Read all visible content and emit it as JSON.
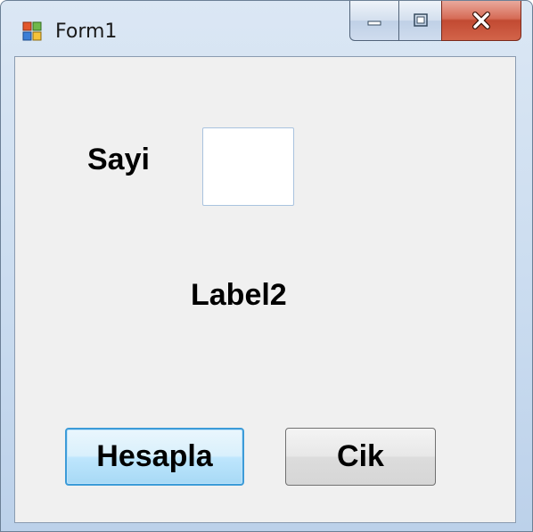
{
  "window": {
    "title": "Form1"
  },
  "form": {
    "sayi_label": "Sayi",
    "sayi_input_value": "",
    "result_label": "Label2",
    "hesapla_button": "Hesapla",
    "cik_button": "Cik"
  },
  "icons": {
    "app": "windows-form-icon",
    "minimize": "minimize-icon",
    "maximize": "maximize-icon",
    "close": "close-icon"
  },
  "colors": {
    "close_button": "#c24a32",
    "focus_border": "#3c9bd8",
    "client_background": "#f0f0f0"
  }
}
